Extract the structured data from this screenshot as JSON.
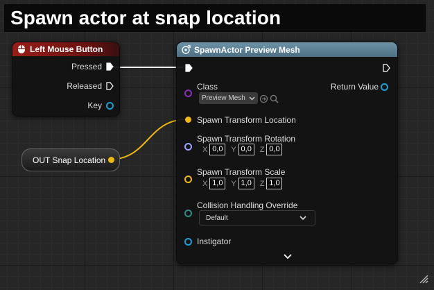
{
  "banner": {
    "title": "Spawn actor at snap location"
  },
  "colors": {
    "event_header": "#8e1a16",
    "function_header": "#5a7d90",
    "exec": "#ffffff",
    "vector": "#f0b90f",
    "rotator": "#9aa4ff",
    "class": "#8b2fb5",
    "object": "#1c9fd6",
    "struct": "#2f8c80"
  },
  "event_node": {
    "title": "Left Mouse Button",
    "icon": "mouse-icon",
    "pins": {
      "pressed": "Pressed",
      "released": "Released",
      "key": "Key"
    }
  },
  "variable_node": {
    "label": "OUT Snap Location"
  },
  "function_node": {
    "title": "SpawnActor Preview Mesh",
    "icon": "spawn-actor-icon",
    "class_label": "Class",
    "class_value": "Preview Mesh",
    "return_value_label": "Return Value",
    "location_label": "Spawn Transform Location",
    "rotation_label": "Spawn Transform Rotation",
    "rotation": {
      "x": "0,0",
      "y": "0,0",
      "z": "0,0"
    },
    "scale_label": "Spawn Transform Scale",
    "scale": {
      "x": "1,0",
      "y": "1,0",
      "z": "1,0"
    },
    "axis_labels": {
      "x": "X",
      "y": "Y",
      "z": "Z"
    },
    "collision_label": "Collision Handling Override",
    "collision_value": "Default",
    "instigator_label": "Instigator"
  }
}
